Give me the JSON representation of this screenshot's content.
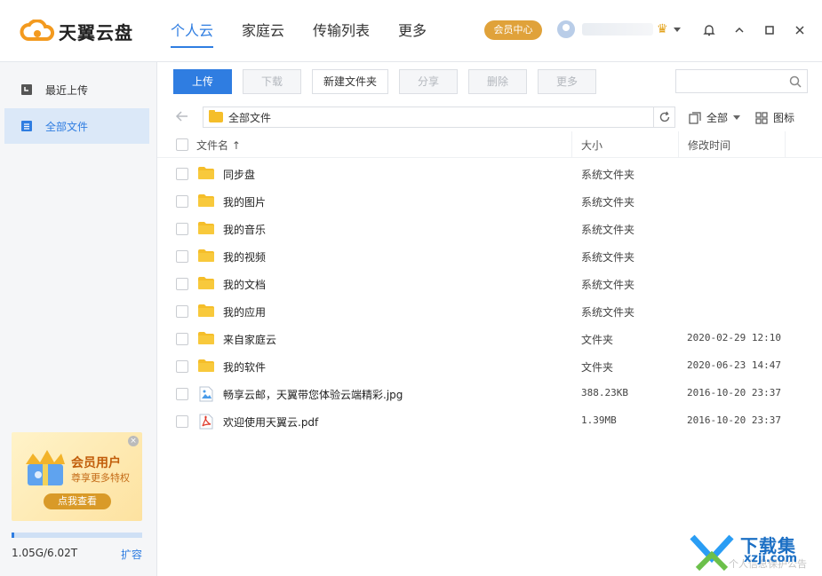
{
  "app": {
    "logo_text": "天翼云盘"
  },
  "nav": [
    {
      "label": "个人云"
    },
    {
      "label": "家庭云"
    },
    {
      "label": "传输列表"
    },
    {
      "label": "更多"
    }
  ],
  "header": {
    "member_center": "会员中心"
  },
  "sidebar": {
    "items": [
      {
        "label": "最近上传"
      },
      {
        "label": "全部文件"
      }
    ],
    "promo": {
      "title": "会员用户",
      "subtitle": "尊享更多特权",
      "button": "点我查看",
      "close": "×"
    },
    "quota": {
      "text": "1.05G/6.02T",
      "fill_fraction": 0.02,
      "expand": "扩容"
    }
  },
  "toolbar": {
    "upload": "上传",
    "download": "下载",
    "new_folder": "新建文件夹",
    "share": "分享",
    "delete": "删除",
    "more": "更多"
  },
  "search": {
    "placeholder": ""
  },
  "path": {
    "current": "全部文件"
  },
  "filter": {
    "label": "全部"
  },
  "view": {
    "label": "图标"
  },
  "table": {
    "headers": {
      "name": "文件名 ↑",
      "size": "大小",
      "mtime": "修改时间"
    },
    "rows": [
      {
        "name": "同步盘",
        "size": "系统文件夹",
        "mtime": "",
        "type": "folder"
      },
      {
        "name": "我的图片",
        "size": "系统文件夹",
        "mtime": "",
        "type": "folder"
      },
      {
        "name": "我的音乐",
        "size": "系统文件夹",
        "mtime": "",
        "type": "folder"
      },
      {
        "name": "我的视频",
        "size": "系统文件夹",
        "mtime": "",
        "type": "folder"
      },
      {
        "name": "我的文档",
        "size": "系统文件夹",
        "mtime": "",
        "type": "folder"
      },
      {
        "name": "我的应用",
        "size": "系统文件夹",
        "mtime": "",
        "type": "folder"
      },
      {
        "name": "来自家庭云",
        "size": "文件夹",
        "mtime": "2020-02-29 12:10",
        "type": "folder"
      },
      {
        "name": "我的软件",
        "size": "文件夹",
        "mtime": "2020-06-23 14:47",
        "type": "folder"
      },
      {
        "name": "畅享云邮，天翼带您体验云端精彩.jpg",
        "size": "388.23KB",
        "mtime": "2016-10-20 23:37",
        "type": "image"
      },
      {
        "name": "欢迎使用天翼云.pdf",
        "size": "1.39MB",
        "mtime": "2016-10-20 23:37",
        "type": "pdf"
      }
    ]
  },
  "watermark": {
    "title": "下载集",
    "url": "xzji.com",
    "faint": "个人信息保护公告"
  },
  "colors": {
    "accent": "#2f7de1",
    "folder": "#f5be2a",
    "member": "#e0a23a"
  }
}
